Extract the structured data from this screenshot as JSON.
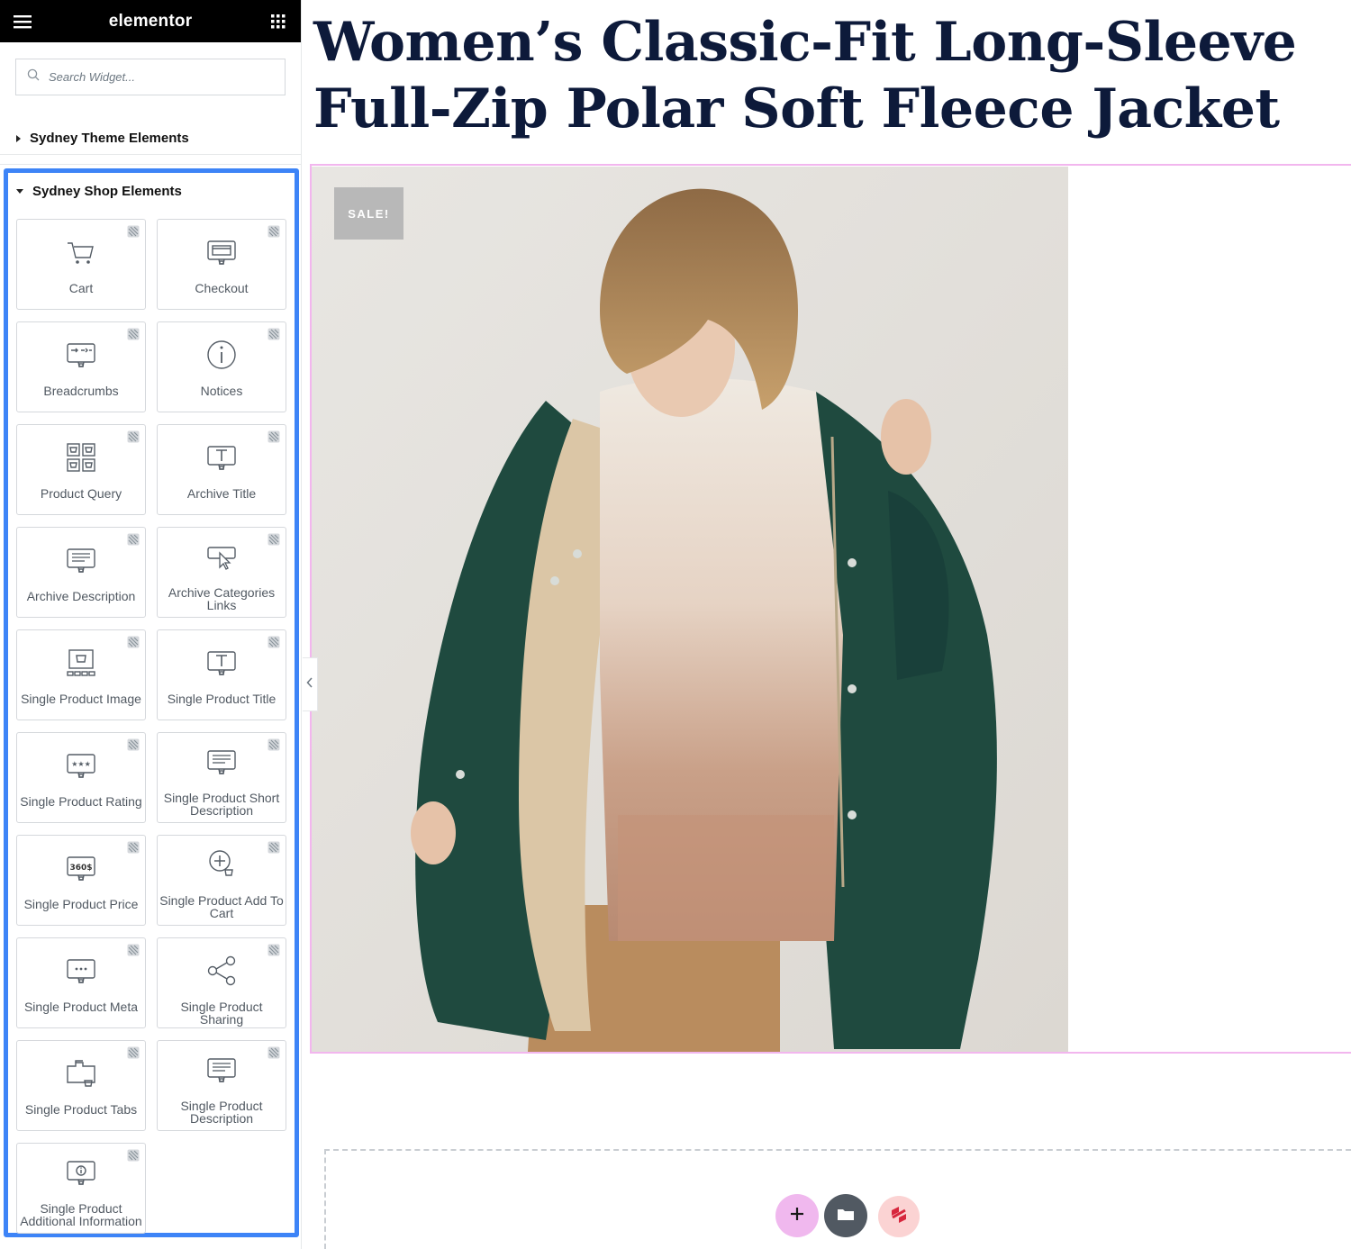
{
  "sidebar": {
    "brand": "elementor",
    "search_placeholder": "Search Widget...",
    "categories": {
      "theme": "Sydney Theme Elements",
      "shop": "Sydney Shop Elements"
    },
    "widgets": [
      {
        "label": "Cart",
        "icon": "cart-icon"
      },
      {
        "label": "Checkout",
        "icon": "checkout-icon"
      },
      {
        "label": "Breadcrumbs",
        "icon": "breadcrumbs-icon"
      },
      {
        "label": "Notices",
        "icon": "info-icon"
      },
      {
        "label": "Product Query",
        "icon": "product-grid-icon"
      },
      {
        "label": "Archive Title",
        "icon": "title-icon"
      },
      {
        "label": "Archive Description",
        "icon": "description-icon"
      },
      {
        "label": "Archive Categories Links",
        "icon": "pointer-icon"
      },
      {
        "label": "Single Product Image",
        "icon": "product-image-icon"
      },
      {
        "label": "Single Product Title",
        "icon": "title-icon"
      },
      {
        "label": "Single Product Rating",
        "icon": "rating-icon"
      },
      {
        "label": "Single Product Short Description",
        "icon": "description-icon"
      },
      {
        "label": "Single Product Price",
        "icon": "price-icon"
      },
      {
        "label": "Single Product Add To Cart",
        "icon": "add-to-cart-icon"
      },
      {
        "label": "Single Product Meta",
        "icon": "meta-icon"
      },
      {
        "label": "Single Product Sharing",
        "icon": "share-icon"
      },
      {
        "label": "Single Product Tabs",
        "icon": "tabs-icon"
      },
      {
        "label": "Single Product Description",
        "icon": "description-icon"
      },
      {
        "label": "Single Product Additional Information",
        "icon": "additional-info-icon"
      }
    ]
  },
  "main": {
    "title_line1": "Women’s Classic-Fit Long-Sleeve",
    "title_line2": "Full-Zip Polar Soft Fleece Jacket",
    "sale_badge": "SALE!"
  },
  "colors": {
    "accent": "#3d84f7",
    "title": "#0d1a3a",
    "pink": "#f0b8ee",
    "dark": "#515962",
    "jacket": "#1f4a3f"
  }
}
